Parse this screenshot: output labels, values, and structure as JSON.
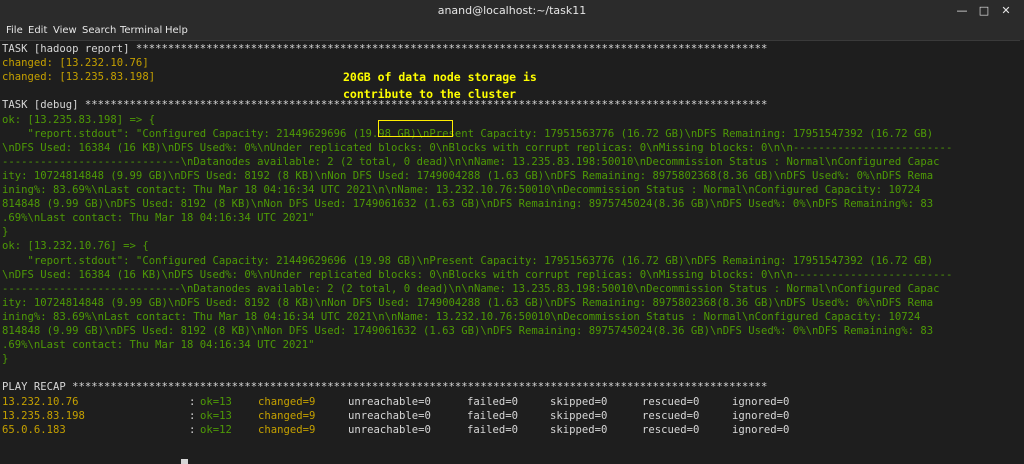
{
  "window": {
    "title": "anand@localhost:~/task11"
  },
  "menu": [
    "File",
    "Edit",
    "View",
    "Search",
    "Terminal",
    "Help"
  ],
  "annotation": {
    "line1": "20GB of data node storage is",
    "line2": "contribute to the cluster"
  },
  "lines": [
    {
      "c": "w",
      "t": "TASK [hadoop report] ***************************************************************************************************"
    },
    {
      "c": "y",
      "t": "changed: [13.232.10.76]"
    },
    {
      "c": "y",
      "t": "changed: [13.235.83.198]"
    },
    {
      "c": "w",
      "t": ""
    },
    {
      "c": "w",
      "t": "TASK [debug] ***********************************************************************************************************"
    },
    {
      "c": "g",
      "t": "ok: [13.235.83.198] => {"
    },
    {
      "c": "g",
      "t": "    \"report.stdout\": \"Configured Capacity: 21449629696 (19.98 GB)\\nPresent Capacity: 17951563776 (16.72 GB)\\nDFS Remaining: 17951547392 (16.72 GB)"
    },
    {
      "c": "g",
      "t": "\\nDFS Used: 16384 (16 KB)\\nDFS Used%: 0%\\nUnder replicated blocks: 0\\nBlocks with corrupt replicas: 0\\nMissing blocks: 0\\n\\n-------------------------"
    },
    {
      "c": "g",
      "t": "----------------------------\\nDatanodes available: 2 (2 total, 0 dead)\\n\\nName: 13.235.83.198:50010\\nDecommission Status : Normal\\nConfigured Capac"
    },
    {
      "c": "g",
      "t": "ity: 10724814848 (9.99 GB)\\nDFS Used: 8192 (8 KB)\\nNon DFS Used: 1749004288 (1.63 GB)\\nDFS Remaining: 8975802368(8.36 GB)\\nDFS Used%: 0%\\nDFS Rema"
    },
    {
      "c": "g",
      "t": "ining%: 83.69%\\nLast contact: Thu Mar 18 04:16:34 UTC 2021\\n\\nName: 13.232.10.76:50010\\nDecommission Status : Normal\\nConfigured Capacity: 10724"
    },
    {
      "c": "g",
      "t": "814848 (9.99 GB)\\nDFS Used: 8192 (8 KB)\\nNon DFS Used: 1749061632 (1.63 GB)\\nDFS Remaining: 8975745024(8.36 GB)\\nDFS Used%: 0%\\nDFS Remaining%: 83"
    },
    {
      "c": "g",
      "t": ".69%\\nLast contact: Thu Mar 18 04:16:34 UTC 2021\""
    },
    {
      "c": "g",
      "t": "}"
    },
    {
      "c": "g",
      "t": "ok: [13.232.10.76] => {"
    },
    {
      "c": "g",
      "t": "    \"report.stdout\": \"Configured Capacity: 21449629696 (19.98 GB)\\nPresent Capacity: 17951563776 (16.72 GB)\\nDFS Remaining: 17951547392 (16.72 GB)"
    },
    {
      "c": "g",
      "t": "\\nDFS Used: 16384 (16 KB)\\nDFS Used%: 0%\\nUnder replicated blocks: 0\\nBlocks with corrupt replicas: 0\\nMissing blocks: 0\\n\\n-------------------------"
    },
    {
      "c": "g",
      "t": "----------------------------\\nDatanodes available: 2 (2 total, 0 dead)\\n\\nName: 13.235.83.198:50010\\nDecommission Status : Normal\\nConfigured Capac"
    },
    {
      "c": "g",
      "t": "ity: 10724814848 (9.99 GB)\\nDFS Used: 8192 (8 KB)\\nNon DFS Used: 1749004288 (1.63 GB)\\nDFS Remaining: 8975802368(8.36 GB)\\nDFS Used%: 0%\\nDFS Rema"
    },
    {
      "c": "g",
      "t": "ining%: 83.69%\\nLast contact: Thu Mar 18 04:16:34 UTC 2021\\n\\nName: 13.232.10.76:50010\\nDecommission Status : Normal\\nConfigured Capacity: 10724"
    },
    {
      "c": "g",
      "t": "814848 (9.99 GB)\\nDFS Used: 8192 (8 KB)\\nNon DFS Used: 1749061632 (1.63 GB)\\nDFS Remaining: 8975745024(8.36 GB)\\nDFS Used%: 0%\\nDFS Remaining%: 83"
    },
    {
      "c": "g",
      "t": ".69%\\nLast contact: Thu Mar 18 04:16:34 UTC 2021\""
    },
    {
      "c": "g",
      "t": "}"
    },
    {
      "c": "w",
      "t": ""
    },
    {
      "c": "w",
      "t": "PLAY RECAP *************************************************************************************************************"
    }
  ],
  "recap": [
    {
      "host": "13.232.10.76",
      "ok": "ok=13",
      "changed": "changed=9",
      "unreachable": "unreachable=0",
      "failed": "failed=0",
      "skipped": "skipped=0",
      "rescued": "rescued=0",
      "ignored": "ignored=0"
    },
    {
      "host": "13.235.83.198",
      "ok": "ok=13",
      "changed": "changed=9",
      "unreachable": "unreachable=0",
      "failed": "failed=0",
      "skipped": "skipped=0",
      "rescued": "rescued=0",
      "ignored": "ignored=0"
    },
    {
      "host": "65.0.6.183",
      "ok": "ok=12",
      "changed": "changed=9",
      "unreachable": "unreachable=0",
      "failed": "failed=0",
      "skipped": "skipped=0",
      "rescued": "rescued=0",
      "ignored": "ignored=0"
    }
  ],
  "colors": {
    "green": "#4e9a06",
    "yellow": "#c4a000",
    "annotation": "#ffff00"
  }
}
